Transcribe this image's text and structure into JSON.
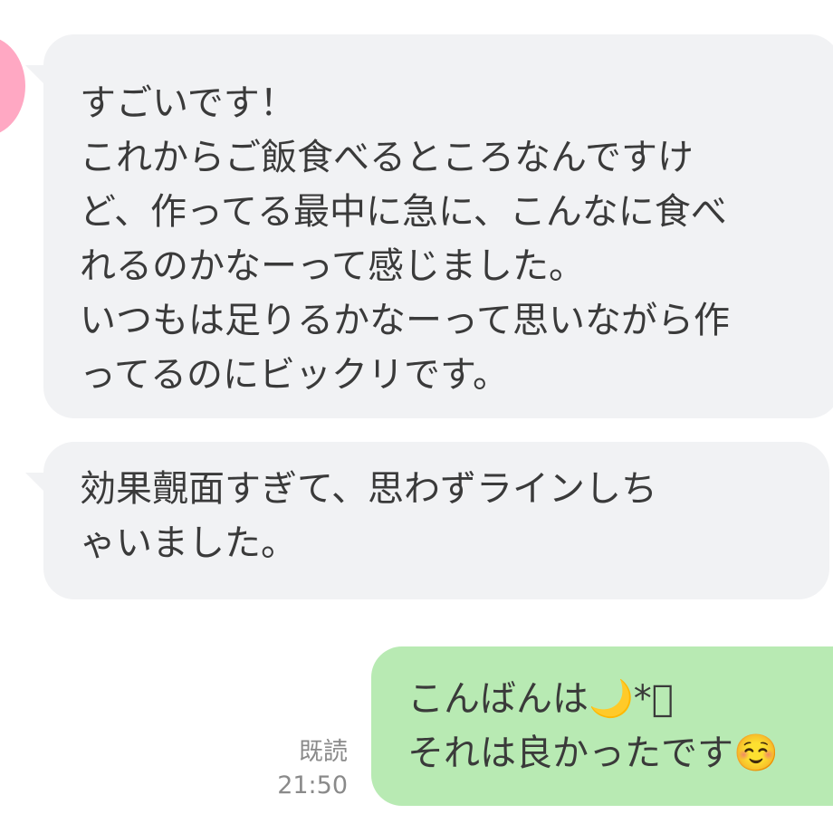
{
  "messages": [
    {
      "direction": "incoming",
      "text": "すごいです！\nこれからご飯食べるところなんですけ\nど、作ってる最中に急に、こんなに食べ\nれるのかなーって感じました。\nいつもは足りるかなーって思いながら作\nってるのにビックリです。"
    },
    {
      "direction": "incoming",
      "text": "効果覿面すぎて、思わずラインしち\nゃいました。"
    },
    {
      "direction": "outgoing",
      "text": "こんばんは🌙*ﾟ\nそれは良かったです☺️",
      "read_status": "既読",
      "time": "21:50"
    }
  ],
  "colors": {
    "incoming_bubble": "#f1f2f4",
    "outgoing_bubble": "#b8eab3",
    "avatar": "#ffa8c3",
    "meta_text": "#8a8a8a"
  },
  "icons": {
    "avatar": "contact-avatar"
  }
}
